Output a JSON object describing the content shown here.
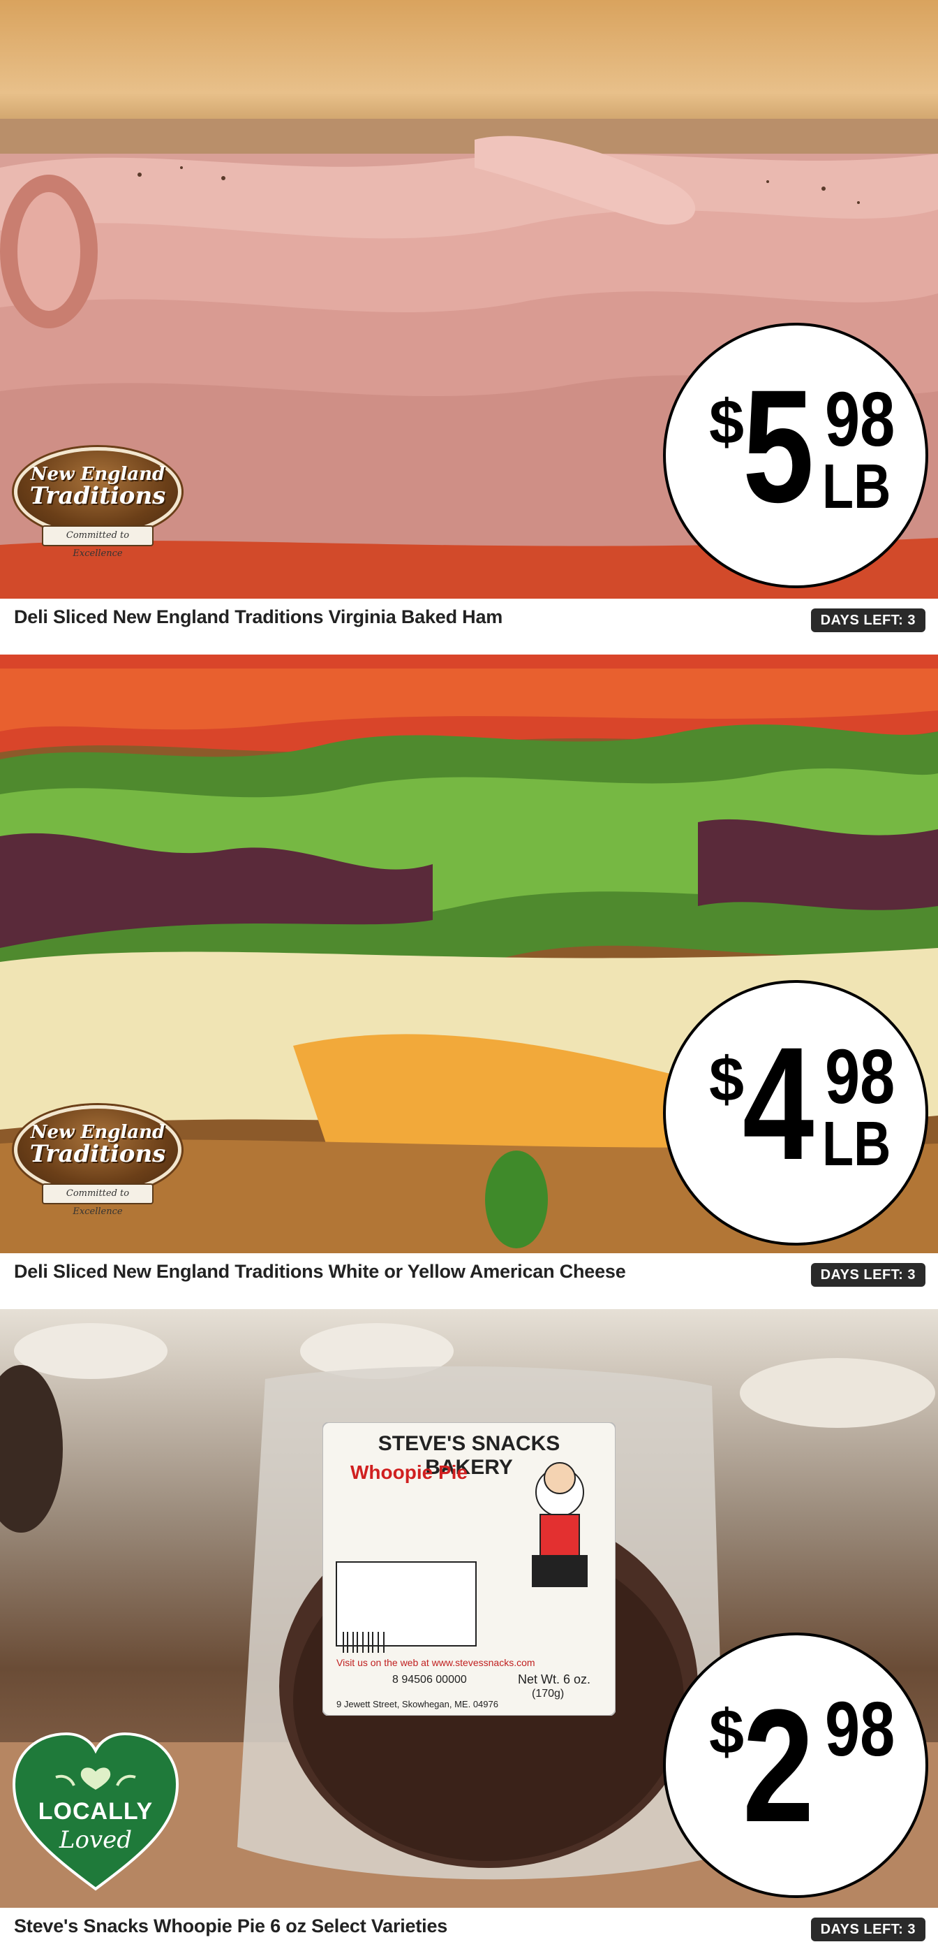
{
  "colors": {
    "badge_bg": "#2a2a2a",
    "local_green": "#1f7a3a",
    "brand_brown": "#6b3f18"
  },
  "products": [
    {
      "title": "Deli Sliced New England Traditions Virginia Baked Ham",
      "days_left": "DAYS LEFT: 3",
      "price": {
        "dollar": "$",
        "whole": "5",
        "cents": "98",
        "unit": "LB"
      },
      "brand": {
        "line1": "New England",
        "line2": "Traditions",
        "ribbon": "Committed to Excellence"
      },
      "image": "ham-slices-sandwich"
    },
    {
      "title": "Deli Sliced New England Traditions White or Yellow American Cheese",
      "days_left": "DAYS LEFT: 3",
      "price": {
        "dollar": "$",
        "whole": "4",
        "cents": "98",
        "unit": "LB"
      },
      "brand": {
        "line1": "New England",
        "line2": "Traditions",
        "ribbon": "Committed to Excellence"
      },
      "image": "cheese-lettuce-tomato-sandwich"
    },
    {
      "title": "Steve's Snacks Whoopie Pie 6 oz Select Varieties",
      "days_left": "DAYS LEFT: 3",
      "price": {
        "dollar": "$",
        "whole": "2",
        "cents": "98",
        "unit": ""
      },
      "badge": {
        "line1": "LOCALLY",
        "line2": "Loved"
      },
      "package": {
        "bakery": "STEVE'S SNACKS BAKERY",
        "product": "Whoopie Pie",
        "web": "Visit us on the web at www.stevessnacks.com",
        "weight": "Net Wt. 6 oz.",
        "weight_g": "(170g)",
        "address": "9 Jewett Street, Skowhegan, ME. 04976",
        "barcode": "8 94506 00000"
      },
      "image": "whoopie-pie-package"
    }
  ]
}
